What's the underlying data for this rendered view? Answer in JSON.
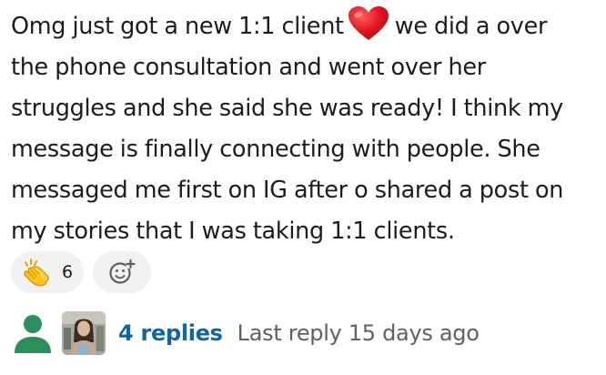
{
  "message": {
    "line1_before": "Omg just got a new 1:1 client",
    "line1_after": "we did a over",
    "line2": "the phone consultation and went over her",
    "line3": "struggles and she said she was ready! I think my",
    "line4": "message is finally connecting with people. She",
    "line5": "messaged me first on IG after o shared a post on",
    "line6": "my stories that I was taking 1:1 clients.",
    "emoji": "heart-icon"
  },
  "reactions": [
    {
      "emoji": "clapping-hands-icon",
      "count": "6"
    },
    {
      "emoji": "add-reaction-icon"
    }
  ],
  "thread": {
    "replies_label": "4 replies",
    "last_reply": "Last reply 15 days ago"
  },
  "colors": {
    "link": "#1264a3",
    "muted": "#616061",
    "avatar_green": "#2e8f5e",
    "heart_red": "#e0141e",
    "reaction_bg": "#f1f1f1"
  }
}
